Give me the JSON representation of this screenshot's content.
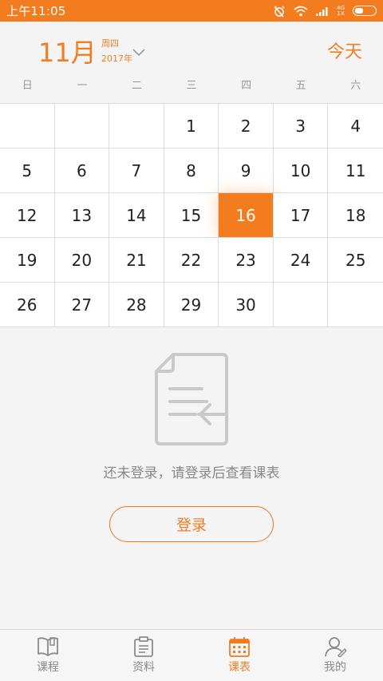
{
  "status_bar": {
    "time": "上午11:05",
    "network_top": "4G",
    "network_bottom": "1X"
  },
  "header": {
    "month": "11月",
    "weekday": "周四",
    "year": "2017年",
    "today_label": "今天"
  },
  "weekdays": [
    "日",
    "一",
    "二",
    "三",
    "四",
    "五",
    "六"
  ],
  "calendar": {
    "days": [
      "",
      "",
      "",
      "1",
      "2",
      "3",
      "4",
      "5",
      "6",
      "7",
      "8",
      "9",
      "10",
      "11",
      "12",
      "13",
      "14",
      "15",
      "16",
      "17",
      "18",
      "19",
      "20",
      "21",
      "22",
      "23",
      "24",
      "25",
      "26",
      "27",
      "28",
      "29",
      "30",
      "",
      ""
    ],
    "selected_day": "16"
  },
  "empty_state": {
    "message": "还未登录，请登录后查看课表",
    "login_label": "登录"
  },
  "nav": {
    "items": [
      {
        "label": "课程",
        "icon": "book-icon"
      },
      {
        "label": "资料",
        "icon": "clipboard-icon"
      },
      {
        "label": "课表",
        "icon": "calendar-icon"
      },
      {
        "label": "我的",
        "icon": "person-icon"
      }
    ],
    "active": "课表"
  },
  "colors": {
    "accent": "#f37c1f",
    "background": "#f4f4f4"
  }
}
